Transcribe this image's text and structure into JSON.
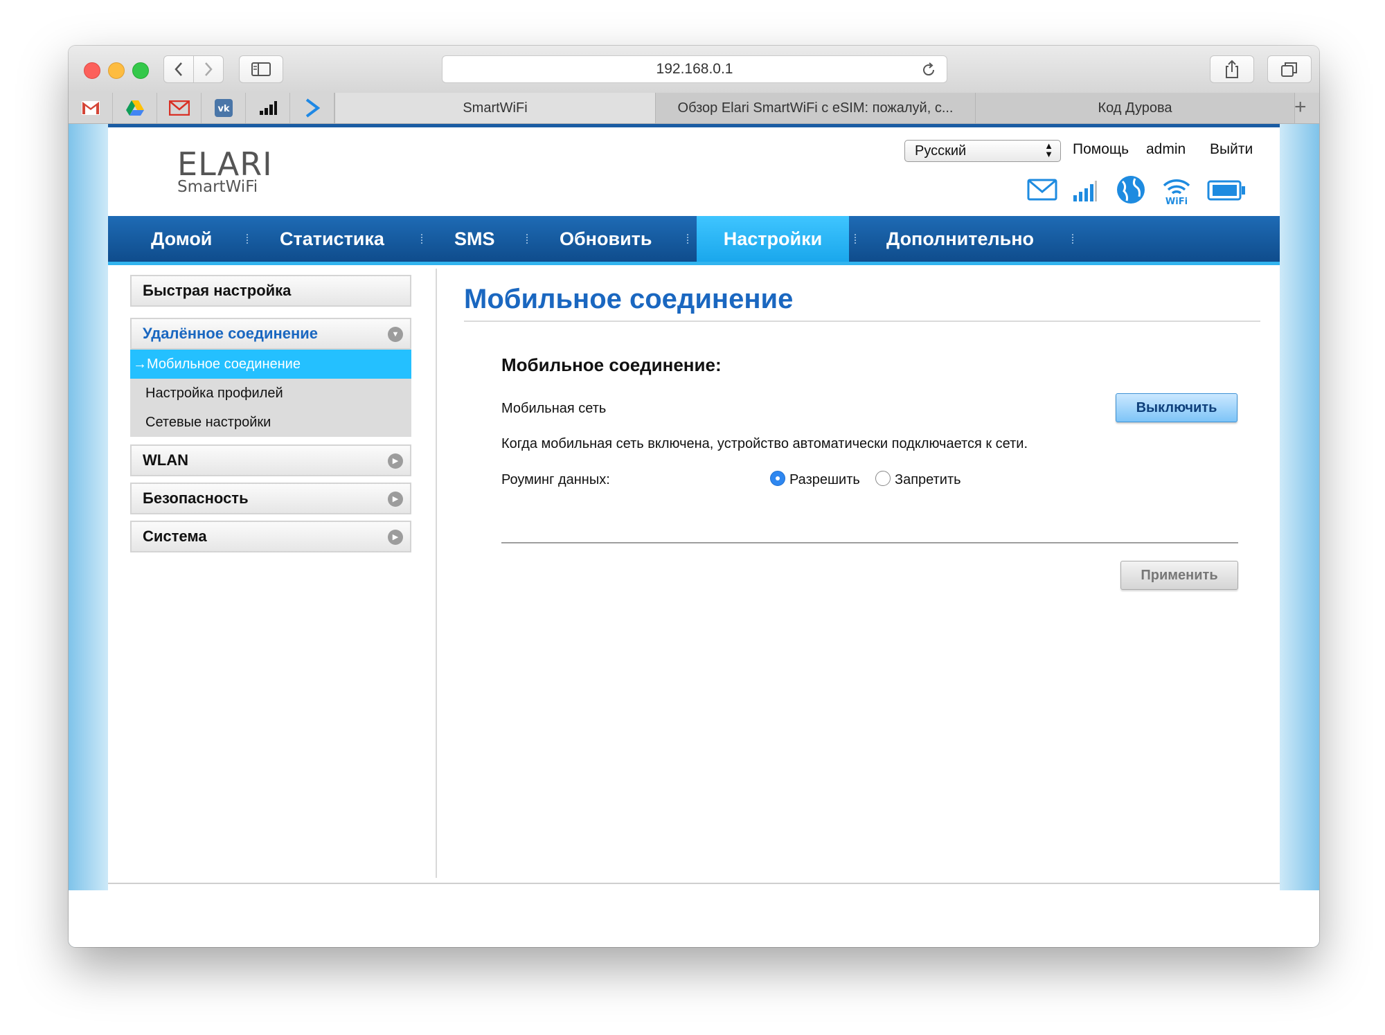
{
  "browser": {
    "url": "192.168.0.1",
    "tabs": [
      {
        "label": "SmartWiFi"
      },
      {
        "label": "Обзор Elari SmartWiFi с eSIM: пожалуй, с..."
      },
      {
        "label": "Код Дурова"
      }
    ],
    "favorites": [
      "gmail-icon",
      "google-drive-icon",
      "mail-icon",
      "vk-icon",
      "signal-icon",
      "arrow-icon"
    ],
    "tab_add": "+"
  },
  "header": {
    "logo_top": "ELARI",
    "logo_bottom": "SmartWiFi",
    "language": "Русский",
    "help": "Помощь",
    "user": "admin",
    "logout": "Выйти",
    "status_icons": [
      "mail-icon",
      "signal-bars-icon",
      "globe-icon",
      "wifi-icon",
      "battery-icon"
    ]
  },
  "nav": {
    "items": [
      {
        "label": "Домой"
      },
      {
        "label": "Статистика"
      },
      {
        "label": "SMS"
      },
      {
        "label": "Обновить"
      },
      {
        "label": "Настройки"
      },
      {
        "label": "Дополнительно"
      }
    ],
    "active": "Настройки"
  },
  "sidebar": {
    "quick_setup": "Быстрая настройка",
    "remote": "Удалённое соединение",
    "remote_sub": [
      {
        "label": "→Мобильное соединение"
      },
      {
        "label": "Настройка профилей"
      },
      {
        "label": "Сетевые настройки"
      }
    ],
    "wlan": "WLAN",
    "security": "Безопасность",
    "system": "Система"
  },
  "main": {
    "title": "Мобильное соединение",
    "section_title": "Мобильное соединение:",
    "mobile_network_label": "Мобильная сеть",
    "mobile_network_button": "Выключить",
    "description": "Когда мобильная сеть включена, устройство автоматически подключается к сети.",
    "roaming_label": "Роуминг данных:",
    "roaming_options": [
      {
        "label": "Разрешить",
        "selected": true
      },
      {
        "label": "Запретить",
        "selected": false
      }
    ],
    "apply_button": "Применить"
  },
  "colors": {
    "nav_blue": "#1a5ca3",
    "nav_active": "#24b5f5",
    "title_blue": "#1a67c0",
    "submenu_active": "#24c0ff"
  }
}
